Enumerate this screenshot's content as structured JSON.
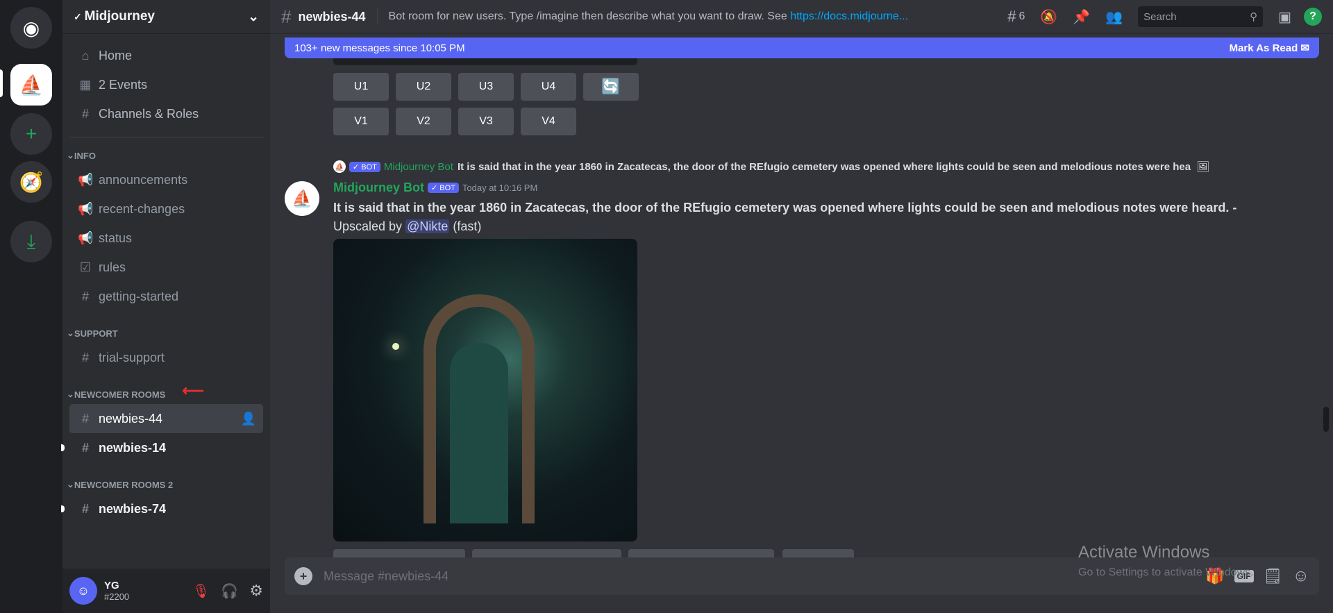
{
  "server": {
    "name": "Midjourney"
  },
  "nav": [
    {
      "label": "Home",
      "icon": "home-icon"
    },
    {
      "label": "2 Events",
      "icon": "calendar-icon"
    },
    {
      "label": "Channels & Roles",
      "icon": "channels-roles-icon"
    }
  ],
  "categories": [
    {
      "name": "INFO",
      "channels": [
        "announcements",
        "recent-changes",
        "status",
        "rules",
        "getting-started"
      ]
    },
    {
      "name": "SUPPORT",
      "channels": [
        "trial-support"
      ]
    },
    {
      "name": "NEWCOMER ROOMS",
      "channels": [
        "newbies-44",
        "newbies-14"
      ]
    },
    {
      "name": "NEWCOMER ROOMS 2",
      "channels": [
        "newbies-74"
      ]
    }
  ],
  "user": {
    "name": "YG",
    "tag": "#2200"
  },
  "header": {
    "channel": "newbies-44",
    "topic": "Bot room for new users. Type /imagine then describe what you want to draw. See ",
    "link": "https://docs.midjourne...",
    "threads": "6",
    "search_placeholder": "Search"
  },
  "banner": {
    "text": "103+ new messages since 10:05 PM",
    "action": "Mark As Read"
  },
  "buttons": {
    "row1": [
      "U1",
      "U2",
      "U3",
      "U4"
    ],
    "row2": [
      "V1",
      "V2",
      "V3",
      "V4"
    ]
  },
  "message": {
    "author": "Midjourney Bot",
    "badge": "✓ BOT",
    "time": "Today at 10:16 PM",
    "reply_text": "It is said that in the year 1860 in Zacatecas, the door of the REfugio cemetery was opened where lights could be seen and melodious notes were hea",
    "content": "It is said that in the year 1860 in Zacatecas, the door of the REfugio cemetery was opened where lights could be seen and melodious notes were heard. -",
    "upscaled": "Upscaled by ",
    "mention": "@Nikte",
    "speed": " (fast)"
  },
  "composer": {
    "placeholder": "Message #newbies-44"
  },
  "watermark": {
    "line1": "Activate Windows",
    "line2": "Go to Settings to activate Windows."
  }
}
